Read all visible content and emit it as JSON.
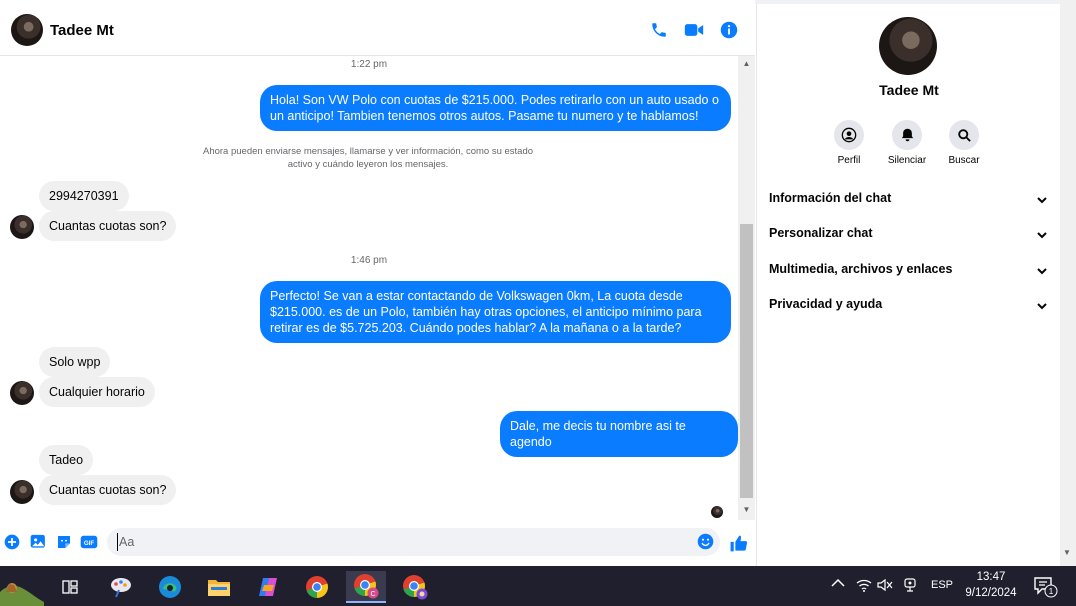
{
  "header": {
    "name": "Tadee Mt"
  },
  "messages": {
    "ts1": "1:22 pm",
    "out1": "Hola! Son VW Polo con cuotas de $215.000. Podes retirarlo con un auto usado o un anticipo! Tambien tenemos otros autos. Pasame tu numero y te hablamos!",
    "system_note": "Ahora pueden enviarse mensajes, llamarse y ver información, como su estado activo y cuándo leyeron los mensajes.",
    "in1": "2994270391",
    "in2": "Cuantas cuotas son?",
    "ts2": "1:46 pm",
    "out2": "Perfecto!  Se van a estar contactando de Volkswagen 0km, La cuota desde $215.000. es de un Polo, también hay otras opciones, el anticipo mínimo para retirar es de $5.725.203. Cuándo podes hablar? A la mañana o a la tarde?",
    "in3": "Solo wpp",
    "in4": "Cualquier horario",
    "out3": "Dale, me decis tu nombre asi te agendo",
    "in5": "Tadeo",
    "in6": "Cuantas cuotas son?"
  },
  "composer": {
    "placeholder": "Aa"
  },
  "side": {
    "name": "Tadee Mt",
    "actions": {
      "profile": "Perfil",
      "mute": "Silenciar",
      "search": "Buscar"
    },
    "sections": {
      "info": "Información del chat",
      "customize": "Personalizar chat",
      "media": "Multimedia, archivos y enlaces",
      "privacy": "Privacidad y ayuda"
    }
  },
  "taskbar": {
    "lang": "ESP",
    "time": "13:47",
    "date": "9/12/2024",
    "notif_count": "1"
  },
  "colors": {
    "accent": "#0a7cff",
    "incoming": "#f0f0f0",
    "taskbar": "#1f1f2e"
  }
}
